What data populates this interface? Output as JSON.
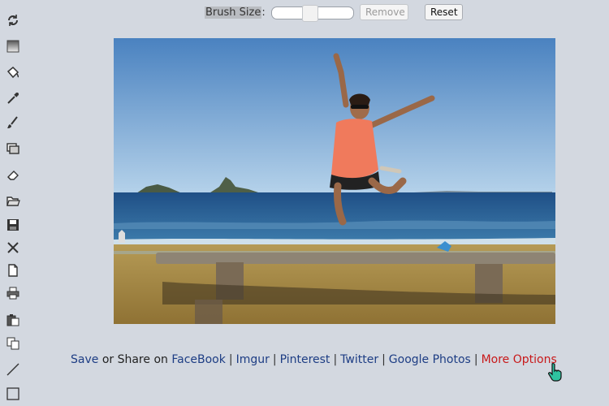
{
  "toolbar": {
    "icons": [
      "rotate-icon",
      "gradient-icon",
      "fill-bucket-icon",
      "eyedropper-icon",
      "brush-icon",
      "crop-icon",
      "eraser-icon",
      "open-folder-icon",
      "save-disk-icon",
      "close-x-icon",
      "new-file-icon",
      "print-icon",
      "paste-icon",
      "copy-icon",
      "line-tool-icon",
      "rectangle-tool-icon"
    ]
  },
  "controls": {
    "brush_size_label": "Brush Size",
    "brush_size_colon": ":",
    "brush_size_value": 0.45,
    "remove_label": "Remove",
    "reset_label": "Reset"
  },
  "share": {
    "save_label": "Save",
    "or_share_text": " or Share on ",
    "links": [
      "FaceBook",
      "Imgur",
      "Pinterest",
      "Twitter",
      "Google Photos"
    ],
    "separator": "|",
    "more_label": "More Options"
  },
  "colors": {
    "background": "#d3d8e0",
    "link": "#1d3d84",
    "more_link": "#c8191a",
    "sky_top": "#4c84c0",
    "sea": "#2d6aa0",
    "sand": "#a88a45",
    "shirt": "#f07a5c"
  }
}
